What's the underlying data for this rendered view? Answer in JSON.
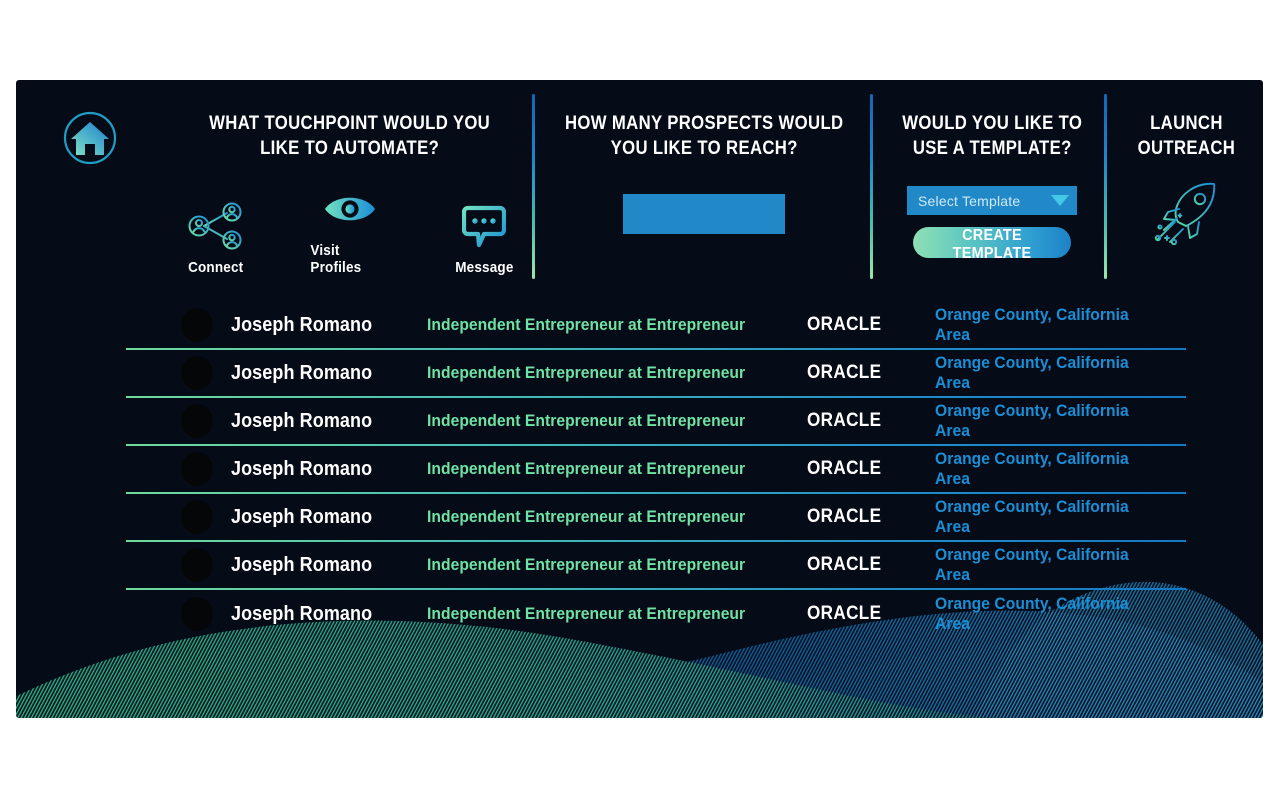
{
  "app": {
    "background_color": "#060b18",
    "accent_blue": "#2189c8",
    "accent_green": "#6fe2a4",
    "link_blue": "#1a8fd6"
  },
  "header": {
    "home_icon": "home-icon",
    "touchpoint": {
      "title": "WHAT TOUCHPOINT WOULD YOU\nLIKE TO AUTOMATE?",
      "options": [
        {
          "label": "Connect",
          "icon": "network-people-icon"
        },
        {
          "label": "Visit Profiles",
          "icon": "eye-icon"
        },
        {
          "label": "Message",
          "icon": "speech-bubble-icon"
        }
      ]
    },
    "prospects": {
      "title": "HOW MANY PROSPECTS WOULD\nYOU LIKE TO REACH?",
      "input_value": "",
      "input_placeholder": ""
    },
    "template": {
      "title": "WOULD YOU LIKE TO\nUSE A TEMPLATE?",
      "select_value": "Select Template",
      "select_caret_icon": "chevron-down-icon",
      "create_button_label": "CREATE TEMPLATE"
    },
    "launch": {
      "title": "LAUNCH\nOUTREACH",
      "icon": "rocket-icon"
    }
  },
  "table": {
    "rows": [
      {
        "avatar": "avatar-placeholder",
        "name": "Joseph Romano",
        "headline": "Independent Entrepreneur at Entrepreneur",
        "company": "ORACLE",
        "location": "Orange County, California Area"
      },
      {
        "avatar": "avatar-placeholder",
        "name": "Joseph Romano",
        "headline": "Independent Entrepreneur at Entrepreneur",
        "company": "ORACLE",
        "location": "Orange County, California Area"
      },
      {
        "avatar": "avatar-placeholder",
        "name": "Joseph Romano",
        "headline": "Independent Entrepreneur at Entrepreneur",
        "company": "ORACLE",
        "location": "Orange County, California Area"
      },
      {
        "avatar": "avatar-placeholder",
        "name": "Joseph Romano",
        "headline": "Independent Entrepreneur at Entrepreneur",
        "company": "ORACLE",
        "location": "Orange County, California Area"
      },
      {
        "avatar": "avatar-placeholder",
        "name": "Joseph Romano",
        "headline": "Independent Entrepreneur at Entrepreneur",
        "company": "ORACLE",
        "location": "Orange County, California Area"
      },
      {
        "avatar": "avatar-placeholder",
        "name": "Joseph Romano",
        "headline": "Independent Entrepreneur at Entrepreneur",
        "company": "ORACLE",
        "location": "Orange County, California Area"
      },
      {
        "avatar": "avatar-placeholder",
        "name": "Joseph Romano",
        "headline": "Independent Entrepreneur at Entrepreneur",
        "company": "ORACLE",
        "location": "Orange County, California Area"
      }
    ]
  }
}
